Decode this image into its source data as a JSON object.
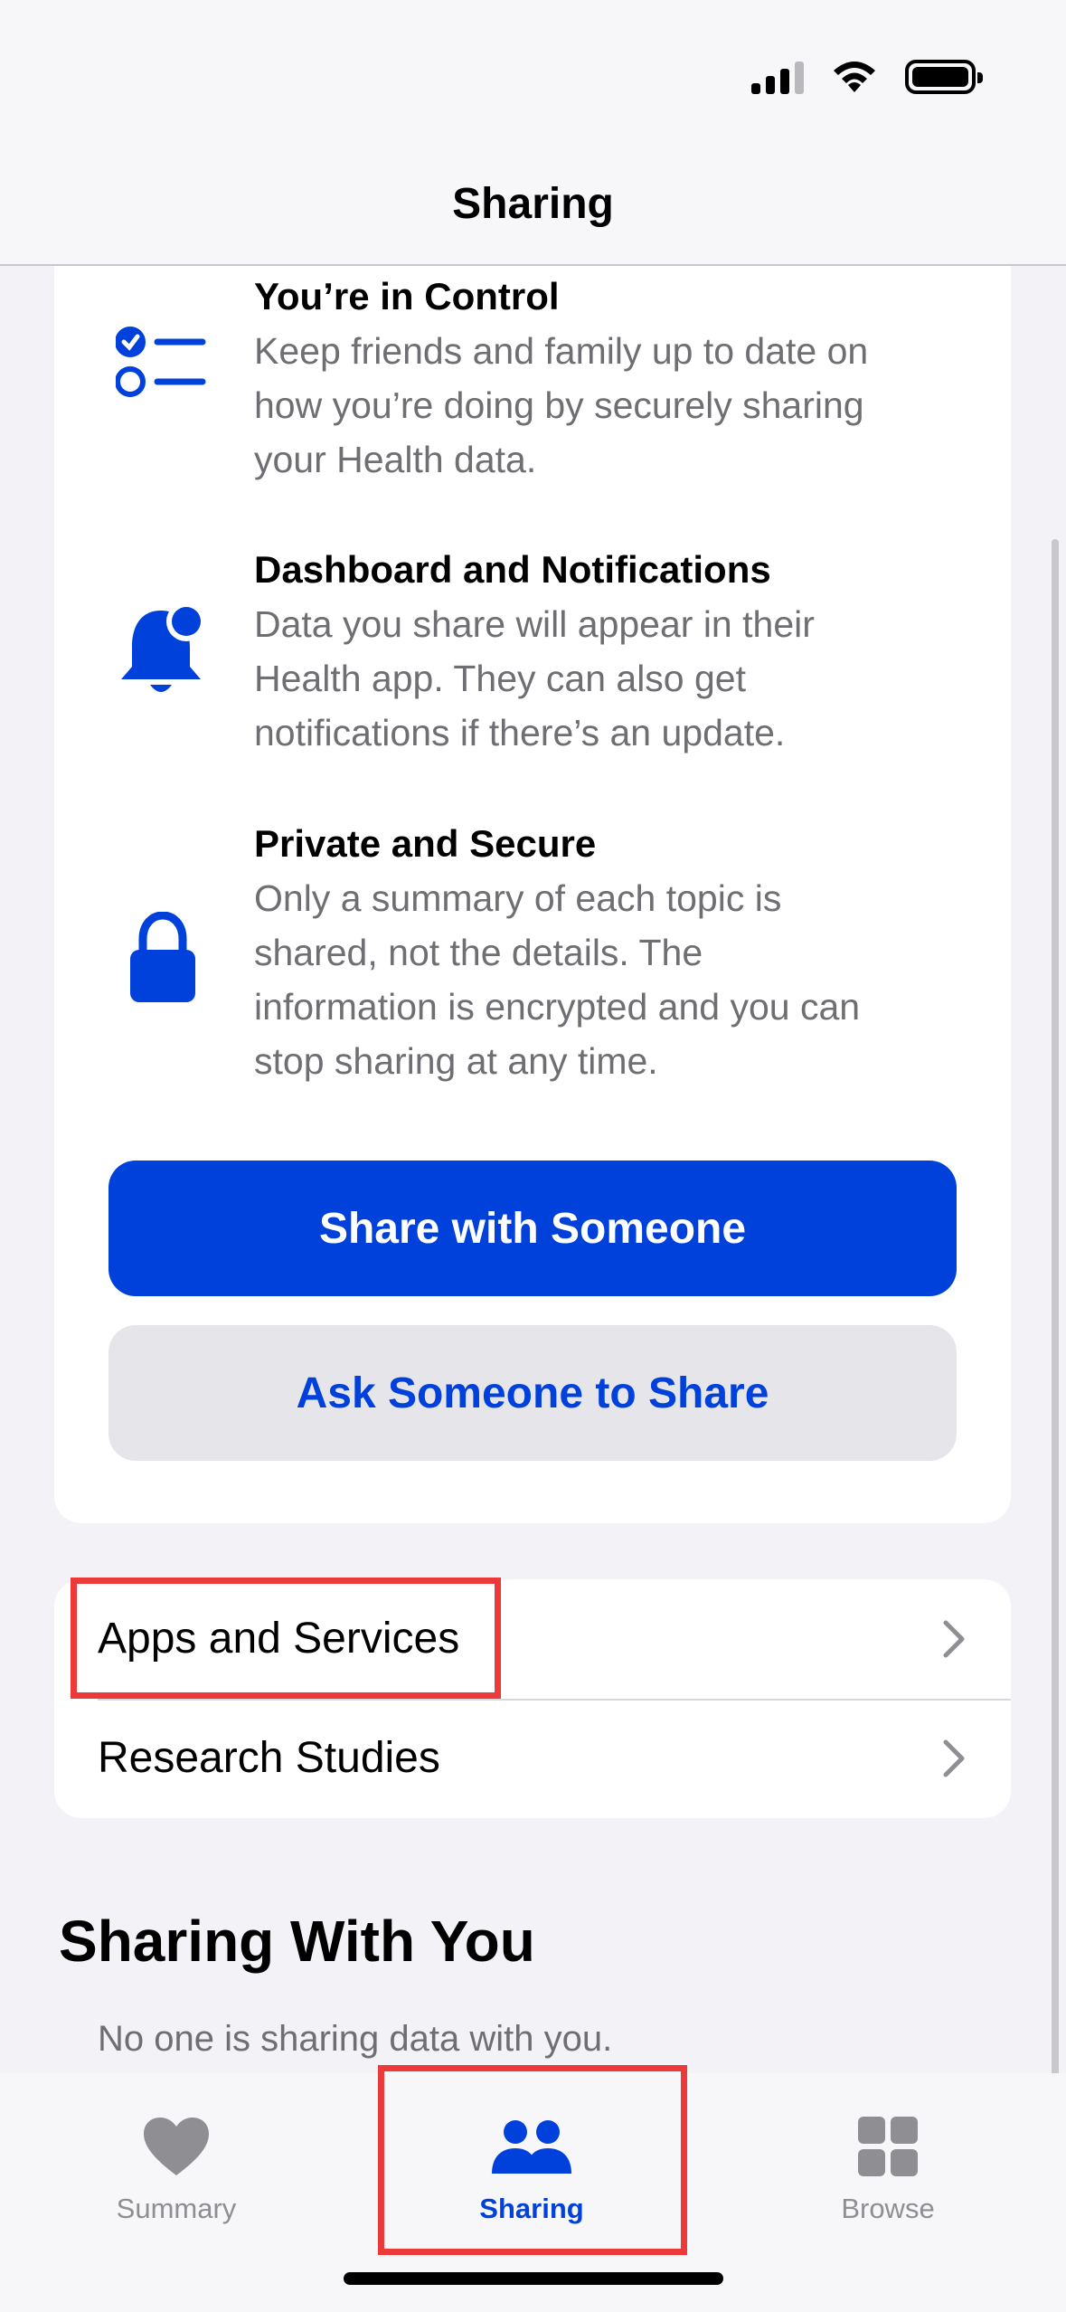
{
  "status_bar": {
    "signal_icon": "cellular-signal-icon",
    "wifi_icon": "wifi-icon",
    "battery_icon": "battery-icon"
  },
  "nav": {
    "title": "Sharing"
  },
  "features": [
    {
      "icon": "checklist-icon",
      "title": "You’re in Control",
      "lines": [
        "Keep friends and family up to date on",
        "how you’re doing by securely sharing",
        "your Health data."
      ]
    },
    {
      "icon": "bell-badge-icon",
      "title": "Dashboard and Notifications",
      "lines": [
        "Data you share will appear in their",
        "Health app. They can also get",
        "notifications if there’s an update."
      ]
    },
    {
      "icon": "lock-icon",
      "title": "Private and Secure",
      "lines": [
        "Only a summary of each topic is",
        "shared, not the details. The",
        "information is encrypted and you can",
        "stop sharing at any time."
      ]
    }
  ],
  "buttons": {
    "share_with_someone": "Share with Someone",
    "ask_someone": "Ask Someone to Share"
  },
  "list": [
    {
      "label": "Apps and Services",
      "icon": "chevron-right-icon"
    },
    {
      "label": "Research Studies",
      "icon": "chevron-right-icon"
    }
  ],
  "sharing_with_you": {
    "title": "Sharing With You",
    "empty": "No one is sharing data with you."
  },
  "tabs": [
    {
      "label": "Summary",
      "icon": "heart-icon",
      "active": false
    },
    {
      "label": "Sharing",
      "icon": "people-icon",
      "active": true
    },
    {
      "label": "Browse",
      "icon": "grid-icon",
      "active": false
    }
  ],
  "colors": {
    "accent": "#0041dc",
    "highlight": "#ec3a3a",
    "secondary_text": "#6e6e73",
    "inactive_tab": "#8e8e93"
  }
}
